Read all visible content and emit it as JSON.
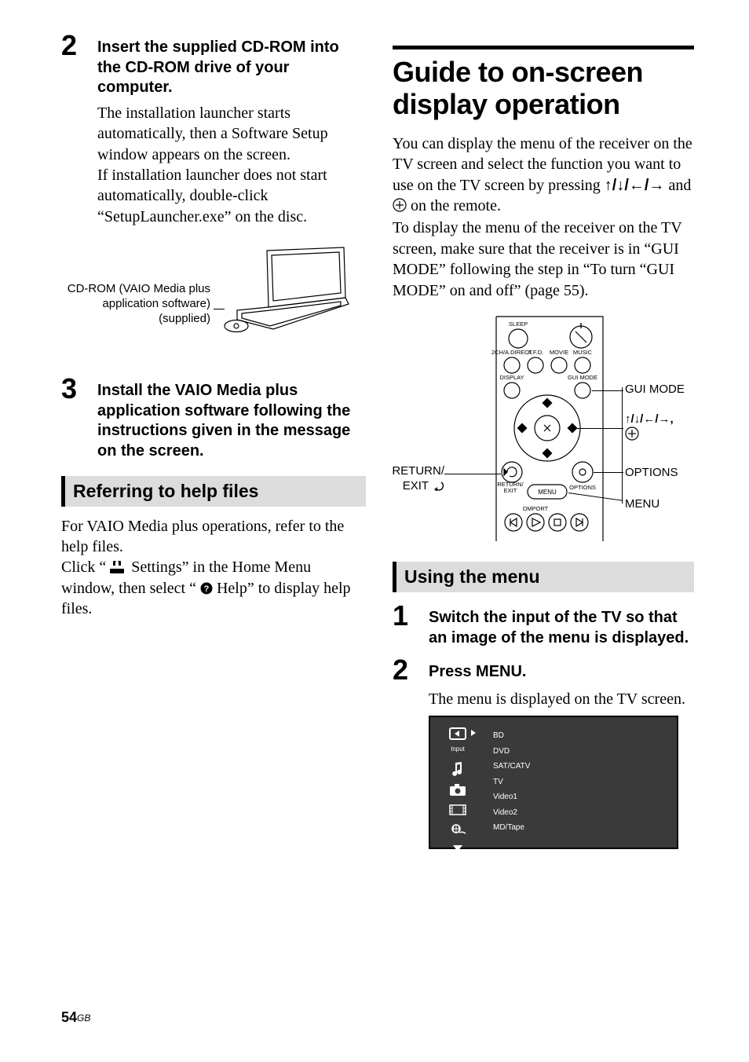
{
  "left": {
    "step2_num": "2",
    "step2_head": "Insert the supplied CD-ROM into the CD-ROM drive of your computer.",
    "step2_body": "The installation launcher starts automatically, then a Software Setup window appears on the screen.\nIf installation launcher does not start automatically, double-click “SetupLauncher.exe” on the disc.",
    "cd_caption": "CD-ROM (VAIO Media plus application software) (supplied)",
    "step3_num": "3",
    "step3_head": "Install the VAIO Media plus application software following the instructions given in the message on the screen.",
    "help_head": "Referring to help files",
    "help_p1": "For VAIO Media plus operations, refer to the help files.",
    "help_p2a": "Click “ ",
    "help_p2b": " Settings” in the Home Menu window, then select “ ",
    "help_p2c": " Help” to display help files."
  },
  "right": {
    "title": "Guide to on-screen display operation",
    "intro_a": "You can display the menu of the receiver on the TV screen and select the function you want to use on the TV screen by pressing ",
    "intro_arrows": "↑/↓/←/→",
    "intro_b": " and ",
    "intro_c": " on the remote.",
    "intro_d": "To display the menu of the receiver on the TV screen, make sure that the receiver is in “GUI MODE” following the step in “To turn “GUI MODE” on and off” (page 55).",
    "remote_labels": {
      "return_exit": "RETURN/\nEXIT ",
      "gui_mode": "GUI MODE",
      "arrows_line": "↑/↓/←/→,",
      "options": "OPTIONS",
      "menu": "MENU"
    },
    "remote_internal": {
      "sleep": "SLEEP",
      "a2chdirect": "2CH/A.DIRECT",
      "afd": "A.F.D.",
      "movie": "MOVIE",
      "music": "MUSIC",
      "display": "DISPLAY",
      "guimode": "GUI MODE",
      "return_exit": "RETURN/\nEXIT",
      "options": "OPTIONS",
      "menu_btn": "MENU",
      "dmport": "DMPORT"
    },
    "using_head": "Using the menu",
    "step1_num": "1",
    "step1_head": "Switch the input of the TV so that an image of the menu is displayed.",
    "step2_num": "2",
    "step2_head": "Press MENU.",
    "step2_body": "The menu is displayed on the TV screen.",
    "tv_menu": {
      "left_label": "Input",
      "items": [
        "BD",
        "DVD",
        "SAT/CATV",
        "TV",
        "Video1",
        "Video2",
        "MD/Tape"
      ]
    }
  },
  "page_num": "54",
  "page_region": "GB"
}
